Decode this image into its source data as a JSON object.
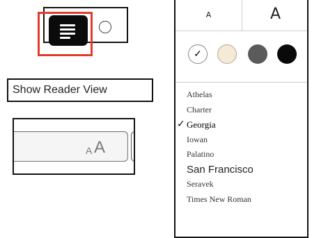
{
  "toolbar": {
    "reader_button_icon": "reader-lines-icon",
    "toggle_icon": "circle-icon",
    "highlight_color": "#e23b2e"
  },
  "tooltip": {
    "text": "Show Reader View"
  },
  "address_bar": {
    "text_size_small": "A",
    "text_size_large": "A"
  },
  "appearance_panel": {
    "size_small_label": "A",
    "size_large_label": "A",
    "themes": [
      {
        "name": "white",
        "color": "#ffffff",
        "selected": true,
        "check": "✓"
      },
      {
        "name": "sepia",
        "color": "#f4ead6",
        "selected": false
      },
      {
        "name": "gray",
        "color": "#5b5b5b",
        "selected": false
      },
      {
        "name": "black",
        "color": "#0a0a0a",
        "selected": false
      }
    ],
    "fonts": [
      {
        "label": "Athelas",
        "selected": false
      },
      {
        "label": "Charter",
        "selected": false
      },
      {
        "label": "Georgia",
        "selected": true,
        "check": "✓"
      },
      {
        "label": "Iowan",
        "selected": false
      },
      {
        "label": "Palatino",
        "selected": false
      },
      {
        "label": "San Francisco",
        "selected": false
      },
      {
        "label": "Seravek",
        "selected": false
      },
      {
        "label": "Times New Roman",
        "selected": false
      }
    ]
  }
}
